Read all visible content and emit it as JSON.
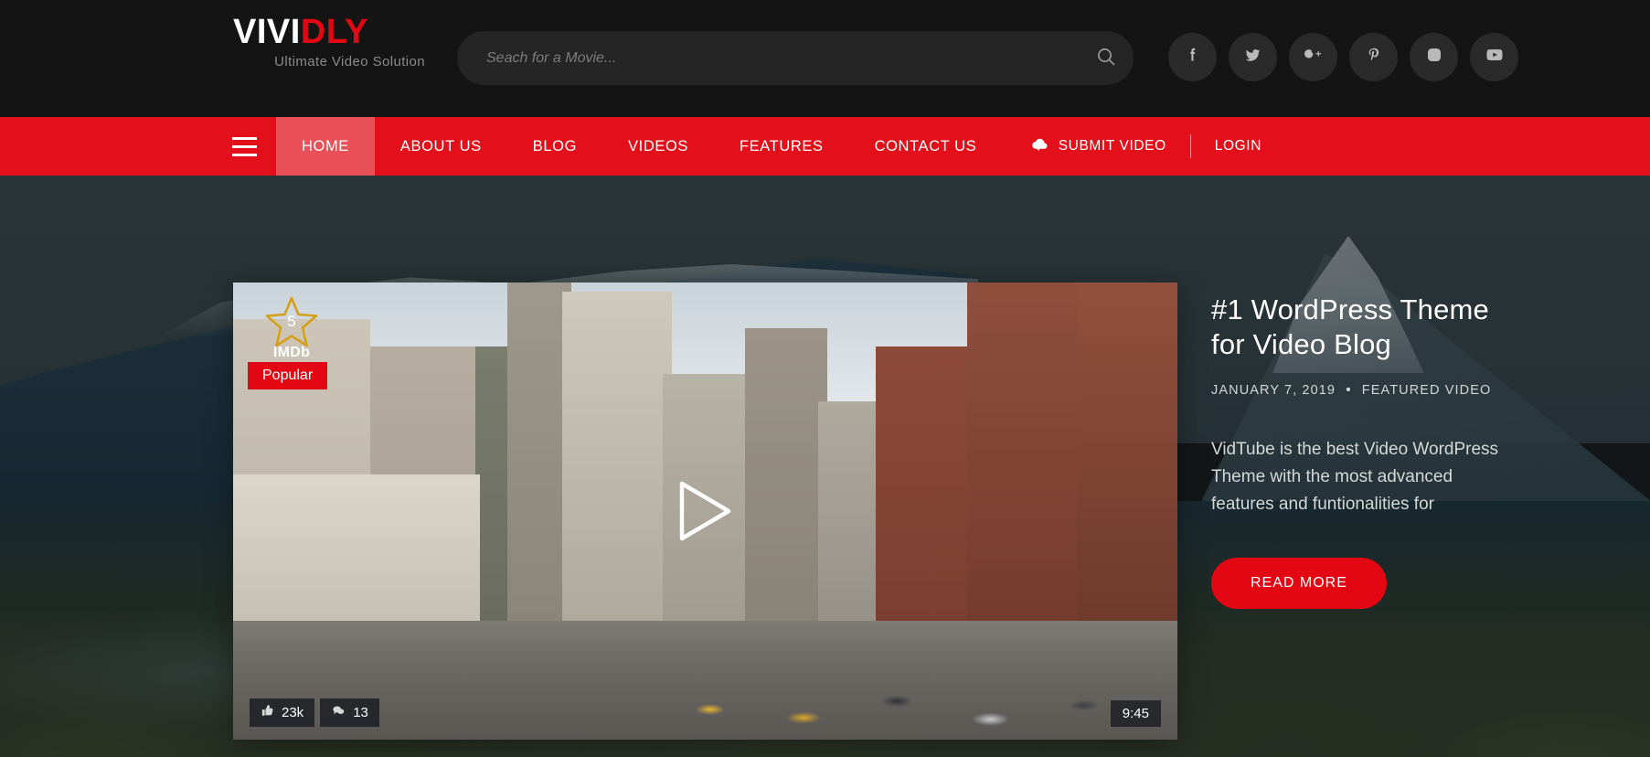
{
  "brand": {
    "name_part1": "VIVI",
    "name_part2": "DLY",
    "tagline": "Ultimate Video Solution"
  },
  "search": {
    "placeholder": "Seach for a Movie...",
    "value": "",
    "icon": "search-icon"
  },
  "socials": [
    {
      "name": "facebook",
      "label": "f"
    },
    {
      "name": "twitter",
      "label": ""
    },
    {
      "name": "google-plus",
      "label": "G+"
    },
    {
      "name": "pinterest",
      "label": "P"
    },
    {
      "name": "instagram",
      "label": ""
    },
    {
      "name": "youtube",
      "label": ""
    }
  ],
  "nav": {
    "menu_icon": "hamburger-icon",
    "items": [
      {
        "label": "HOME",
        "active": true
      },
      {
        "label": "ABOUT US",
        "active": false
      },
      {
        "label": "BLOG",
        "active": false
      },
      {
        "label": "VIDEOS",
        "active": false
      },
      {
        "label": "FEATURES",
        "active": false
      },
      {
        "label": "CONTACT US",
        "active": false
      }
    ],
    "submit_video": "SUBMIT VIDEO",
    "submit_icon": "cloud-upload-icon",
    "login": "LOGIN"
  },
  "hero": {
    "title": "#1 WordPress Theme for Video Blog",
    "date": "JANUARY 7, 2019",
    "separator": "•",
    "category": "FEATURED VIDEO",
    "description": "VidTube is the best Video WordPress Theme with the most advanced features and funtionalities for",
    "read_more": "READ MORE"
  },
  "video": {
    "play_icon": "play-icon",
    "imdb_rating": "5",
    "imdb_label": "IMDb",
    "popular_badge": "Popular",
    "likes": "23k",
    "likes_icon": "thumbs-up-icon",
    "comments": "13",
    "comments_icon": "comment-icon",
    "duration": "9:45"
  },
  "colors": {
    "brand_red": "#e30613",
    "nav_red": "#e3101c",
    "nav_active_red": "#ea5058",
    "header_dark": "#141414",
    "imdb_gold": "#d4a017"
  }
}
